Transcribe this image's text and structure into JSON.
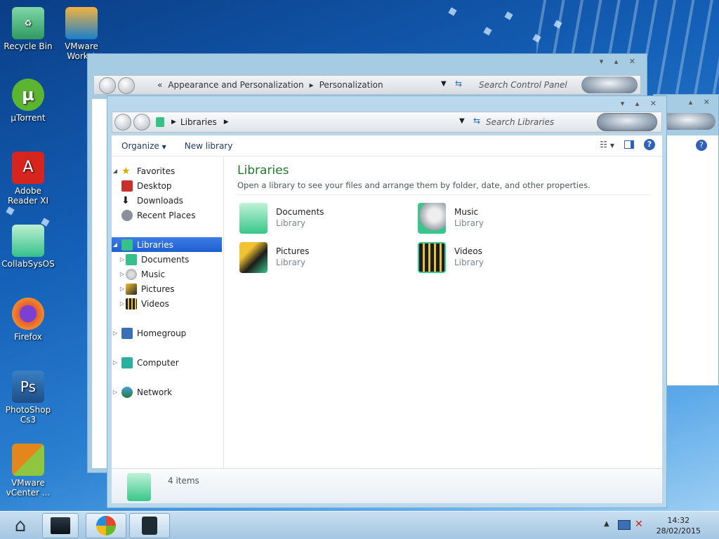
{
  "desktop": {
    "icons": [
      {
        "label": "Recycle Bin",
        "icon": "recycle-bin-icon",
        "color": "#3aa86b"
      },
      {
        "label": "VMware Workst",
        "icon": "vmware-icon",
        "color": "#1a7fcf"
      },
      {
        "label": "µTorrent",
        "icon": "utorrent-icon",
        "color": "#5cb531"
      },
      {
        "label": "Adobe Reader XI",
        "icon": "adobe-reader-icon",
        "color": "#d6241f"
      },
      {
        "label": "CollabSysOS",
        "icon": "folder-icon",
        "color": "#36c08a"
      },
      {
        "label": "Firefox",
        "icon": "firefox-icon",
        "color": "#e8622c"
      },
      {
        "label": "PhotoShop Cs3",
        "icon": "photoshop-icon",
        "color": "#1c4f86"
      },
      {
        "label": "VMware vCenter ...",
        "icon": "vmware-vcenter-icon",
        "color": "#e3861d"
      }
    ]
  },
  "back_window": {
    "breadcrumb": [
      "Appearance and Personalization",
      "Personalization"
    ],
    "search_placeholder": "Search Control Panel"
  },
  "window": {
    "breadcrumb": "Libraries",
    "search_placeholder": "Search Libraries",
    "toolbar": {
      "organize": "Organize",
      "new_library": "New library"
    },
    "nav": {
      "favorites": "Favorites",
      "favorites_items": [
        "Desktop",
        "Downloads",
        "Recent Places"
      ],
      "libraries": "Libraries",
      "libraries_items": [
        "Documents",
        "Music",
        "Pictures",
        "Videos"
      ],
      "homegroup": "Homegroup",
      "computer": "Computer",
      "network": "Network"
    },
    "content": {
      "title": "Libraries",
      "subtitle": "Open a library to see your files and arrange them by folder, date, and other properties.",
      "libraries": [
        {
          "name": "Documents",
          "type": "Library"
        },
        {
          "name": "Music",
          "type": "Library"
        },
        {
          "name": "Pictures",
          "type": "Library"
        },
        {
          "name": "Videos",
          "type": "Library"
        }
      ]
    },
    "details": {
      "count": "4 items"
    }
  },
  "taskbar": {
    "time": "14:32",
    "date": "28/02/2015"
  },
  "colors": {
    "accent": "#1e7a2c",
    "selection": "#2f6fdc"
  }
}
